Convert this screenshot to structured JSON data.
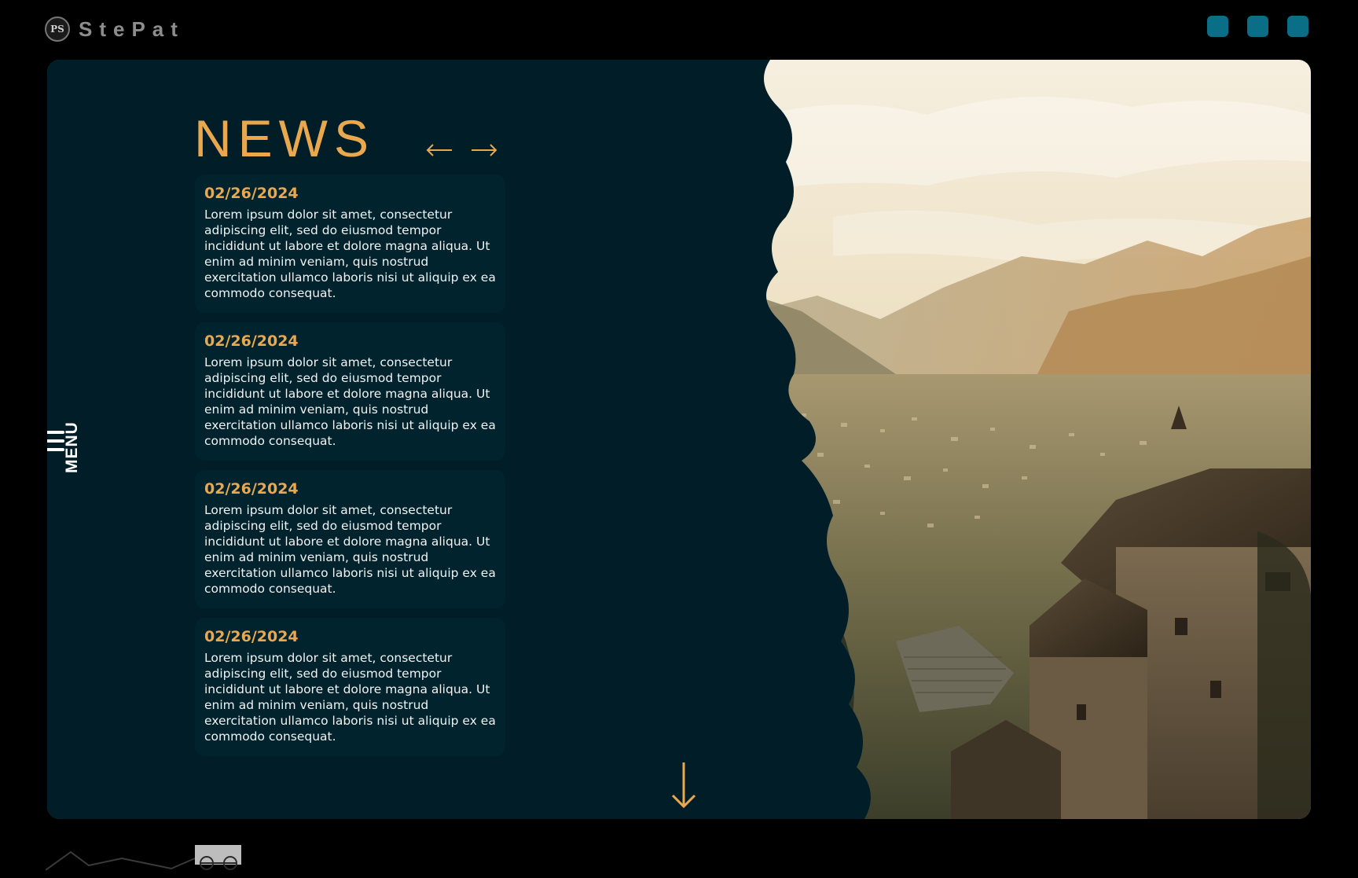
{
  "header": {
    "logo_initials": "PS",
    "brand": "StePat",
    "buttons": [
      "action-1",
      "action-2",
      "action-3"
    ]
  },
  "menu": {
    "label": "MENU",
    "icon": "hamburger-icon"
  },
  "news": {
    "title": "NEWS",
    "prev_icon": "arrow-left-icon",
    "next_icon": "arrow-right-icon",
    "items": [
      {
        "date": "02/26/2024",
        "text": "Lorem ipsum dolor sit amet, consectetur adipiscing elit, sed do eiusmod tempor incididunt ut labore et dolore magna aliqua. Ut enim ad minim veniam, quis nostrud exercitation ullamco laboris nisi ut aliquip ex ea commodo consequat."
      },
      {
        "date": "02/26/2024",
        "text": "Lorem ipsum dolor sit amet, consectetur adipiscing elit, sed do eiusmod tempor incididunt ut labore et dolore magna aliqua. Ut enim ad minim veniam, quis nostrud exercitation ullamco laboris nisi ut aliquip ex ea commodo consequat."
      },
      {
        "date": "02/26/2024",
        "text": "Lorem ipsum dolor sit amet, consectetur adipiscing elit, sed do eiusmod tempor incididunt ut labore et dolore magna aliqua. Ut enim ad minim veniam, quis nostrud exercitation ullamco laboris nisi ut aliquip ex ea commodo consequat."
      },
      {
        "date": "02/26/2024",
        "text": "Lorem ipsum dolor sit amet, consectetur adipiscing elit, sed do eiusmod tempor incididunt ut labore et dolore magna aliqua. Ut enim ad minim veniam, quis nostrud exercitation ullamco laboris nisi ut aliquip ex ea commodo consequat."
      }
    ]
  },
  "scroll": {
    "icon": "arrow-down-icon"
  },
  "colors": {
    "accent": "#e9a84e",
    "teal": "#0a6f86",
    "background": "#000000",
    "text": "#ffffff"
  }
}
